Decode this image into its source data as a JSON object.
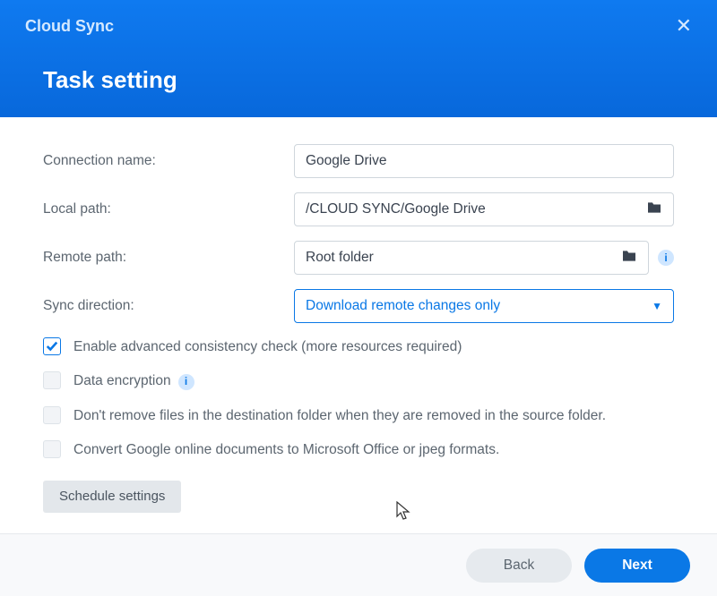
{
  "app_title": "Cloud Sync",
  "page_title": "Task setting",
  "close_glyph": "✕",
  "labels": {
    "connection_name": "Connection name:",
    "local_path": "Local path:",
    "remote_path": "Remote path:",
    "sync_direction": "Sync direction:"
  },
  "values": {
    "connection_name": "Google Drive",
    "local_path": "/CLOUD SYNC/Google Drive",
    "remote_path": "Root folder",
    "sync_direction": "Download remote changes only"
  },
  "checkboxes": {
    "advanced_check": "Enable advanced consistency check (more resources required)",
    "data_encryption": "Data encryption",
    "dont_remove": "Don't remove files in the destination folder when they are removed in the source folder.",
    "convert_docs": "Convert Google online documents to Microsoft Office or jpeg formats."
  },
  "buttons": {
    "schedule": "Schedule settings",
    "back": "Back",
    "next": "Next"
  },
  "info_glyph": "i"
}
